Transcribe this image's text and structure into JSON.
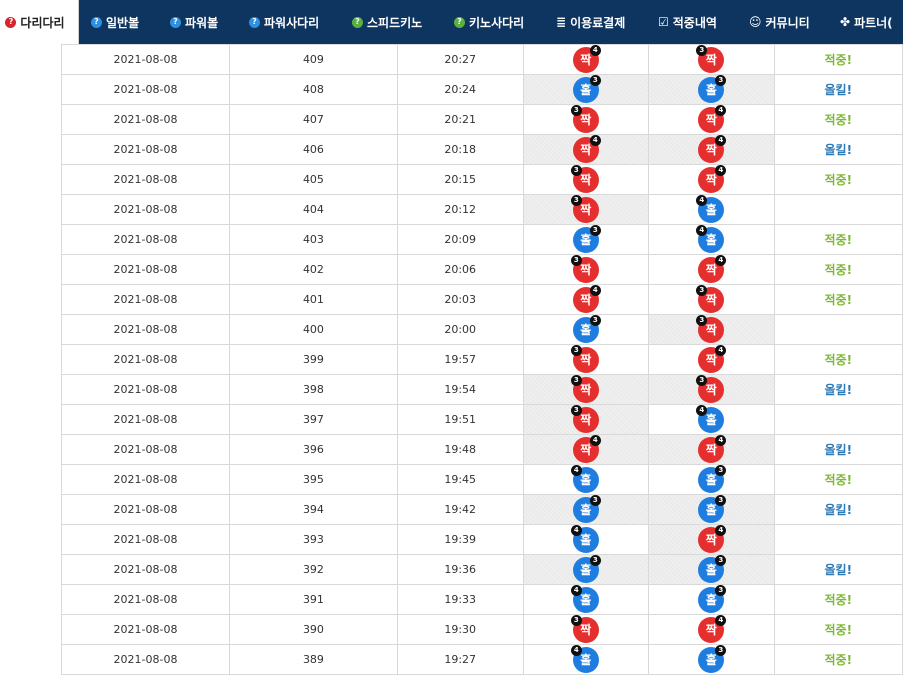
{
  "nav": [
    {
      "label": "다리다리",
      "icon": "question-circle-icon",
      "active": true
    },
    {
      "label": "일반볼",
      "icon": "question-circle-icon"
    },
    {
      "label": "파워볼",
      "icon": "question-circle-icon"
    },
    {
      "label": "파워사다리",
      "icon": "question-circle-icon"
    },
    {
      "label": "스피드키노",
      "icon": "question-circle-icon"
    },
    {
      "label": "키노사다리",
      "icon": "question-circle-icon"
    },
    {
      "label": "이용료결제",
      "icon": "database-icon"
    },
    {
      "label": "적중내역",
      "icon": "check-square-icon"
    },
    {
      "label": "커뮤니티",
      "icon": "smile-icon"
    },
    {
      "label": "파트너(",
      "icon": "cubes-icon"
    }
  ],
  "colors": {
    "nav_bg": "#0e3460",
    "odd_ball": "#1f7de0",
    "even_ball": "#e52e2e",
    "hit_text": "#7cb834",
    "miss_text": "#2a7ab8"
  },
  "labels": {
    "odd": "홀",
    "even": "짝",
    "hit": "적중!",
    "miss": "올킬!"
  },
  "rows": [
    {
      "date": "2021-08-08",
      "round": "409",
      "time": "20:27",
      "result": {
        "type": "even",
        "count": "4",
        "pos": "right"
      },
      "pick": {
        "type": "even",
        "count": "3",
        "pos": "left"
      },
      "status": "hit",
      "status_text": "적중!",
      "hatch_result": false,
      "hatch_pick": false
    },
    {
      "date": "2021-08-08",
      "round": "408",
      "time": "20:24",
      "result": {
        "type": "odd",
        "count": "3",
        "pos": "right"
      },
      "pick": {
        "type": "odd",
        "count": "3",
        "pos": "right"
      },
      "status": "miss",
      "status_text": "올킬!",
      "hatch_result": true,
      "hatch_pick": true
    },
    {
      "date": "2021-08-08",
      "round": "407",
      "time": "20:21",
      "result": {
        "type": "even",
        "count": "3",
        "pos": "left"
      },
      "pick": {
        "type": "even",
        "count": "4",
        "pos": "right"
      },
      "status": "hit",
      "status_text": "적중!",
      "hatch_result": false,
      "hatch_pick": false
    },
    {
      "date": "2021-08-08",
      "round": "406",
      "time": "20:18",
      "result": {
        "type": "even",
        "count": "4",
        "pos": "right"
      },
      "pick": {
        "type": "even",
        "count": "4",
        "pos": "right"
      },
      "status": "miss",
      "status_text": "올킬!",
      "hatch_result": true,
      "hatch_pick": true
    },
    {
      "date": "2021-08-08",
      "round": "405",
      "time": "20:15",
      "result": {
        "type": "even",
        "count": "3",
        "pos": "left"
      },
      "pick": {
        "type": "even",
        "count": "4",
        "pos": "right"
      },
      "status": "hit",
      "status_text": "적중!",
      "hatch_result": false,
      "hatch_pick": false
    },
    {
      "date": "2021-08-08",
      "round": "404",
      "time": "20:12",
      "result": {
        "type": "even",
        "count": "3",
        "pos": "left"
      },
      "pick": {
        "type": "odd",
        "count": "4",
        "pos": "left"
      },
      "status": "",
      "status_text": "",
      "hatch_result": true,
      "hatch_pick": false
    },
    {
      "date": "2021-08-08",
      "round": "403",
      "time": "20:09",
      "result": {
        "type": "odd",
        "count": "3",
        "pos": "right"
      },
      "pick": {
        "type": "odd",
        "count": "4",
        "pos": "left"
      },
      "status": "hit",
      "status_text": "적중!",
      "hatch_result": false,
      "hatch_pick": false
    },
    {
      "date": "2021-08-08",
      "round": "402",
      "time": "20:06",
      "result": {
        "type": "even",
        "count": "3",
        "pos": "left"
      },
      "pick": {
        "type": "even",
        "count": "4",
        "pos": "right"
      },
      "status": "hit",
      "status_text": "적중!",
      "hatch_result": false,
      "hatch_pick": false
    },
    {
      "date": "2021-08-08",
      "round": "401",
      "time": "20:03",
      "result": {
        "type": "even",
        "count": "4",
        "pos": "right"
      },
      "pick": {
        "type": "even",
        "count": "3",
        "pos": "left"
      },
      "status": "hit",
      "status_text": "적중!",
      "hatch_result": false,
      "hatch_pick": false
    },
    {
      "date": "2021-08-08",
      "round": "400",
      "time": "20:00",
      "result": {
        "type": "odd",
        "count": "3",
        "pos": "right"
      },
      "pick": {
        "type": "even",
        "count": "3",
        "pos": "left"
      },
      "status": "",
      "status_text": "",
      "hatch_result": false,
      "hatch_pick": true
    },
    {
      "date": "2021-08-08",
      "round": "399",
      "time": "19:57",
      "result": {
        "type": "even",
        "count": "3",
        "pos": "left"
      },
      "pick": {
        "type": "even",
        "count": "4",
        "pos": "right"
      },
      "status": "hit",
      "status_text": "적중!",
      "hatch_result": false,
      "hatch_pick": false
    },
    {
      "date": "2021-08-08",
      "round": "398",
      "time": "19:54",
      "result": {
        "type": "even",
        "count": "3",
        "pos": "left"
      },
      "pick": {
        "type": "even",
        "count": "3",
        "pos": "left"
      },
      "status": "miss",
      "status_text": "올킬!",
      "hatch_result": true,
      "hatch_pick": true
    },
    {
      "date": "2021-08-08",
      "round": "397",
      "time": "19:51",
      "result": {
        "type": "even",
        "count": "3",
        "pos": "left"
      },
      "pick": {
        "type": "odd",
        "count": "4",
        "pos": "left"
      },
      "status": "",
      "status_text": "",
      "hatch_result": true,
      "hatch_pick": false
    },
    {
      "date": "2021-08-08",
      "round": "396",
      "time": "19:48",
      "result": {
        "type": "even",
        "count": "4",
        "pos": "right"
      },
      "pick": {
        "type": "even",
        "count": "4",
        "pos": "right"
      },
      "status": "miss",
      "status_text": "올킬!",
      "hatch_result": true,
      "hatch_pick": true
    },
    {
      "date": "2021-08-08",
      "round": "395",
      "time": "19:45",
      "result": {
        "type": "odd",
        "count": "4",
        "pos": "left"
      },
      "pick": {
        "type": "odd",
        "count": "3",
        "pos": "right"
      },
      "status": "hit",
      "status_text": "적중!",
      "hatch_result": false,
      "hatch_pick": false
    },
    {
      "date": "2021-08-08",
      "round": "394",
      "time": "19:42",
      "result": {
        "type": "odd",
        "count": "3",
        "pos": "right"
      },
      "pick": {
        "type": "odd",
        "count": "3",
        "pos": "right"
      },
      "status": "miss",
      "status_text": "올킬!",
      "hatch_result": true,
      "hatch_pick": true
    },
    {
      "date": "2021-08-08",
      "round": "393",
      "time": "19:39",
      "result": {
        "type": "odd",
        "count": "4",
        "pos": "left"
      },
      "pick": {
        "type": "even",
        "count": "4",
        "pos": "right"
      },
      "status": "",
      "status_text": "",
      "hatch_result": false,
      "hatch_pick": true
    },
    {
      "date": "2021-08-08",
      "round": "392",
      "time": "19:36",
      "result": {
        "type": "odd",
        "count": "3",
        "pos": "right"
      },
      "pick": {
        "type": "odd",
        "count": "3",
        "pos": "right"
      },
      "status": "miss",
      "status_text": "올킬!",
      "hatch_result": true,
      "hatch_pick": true
    },
    {
      "date": "2021-08-08",
      "round": "391",
      "time": "19:33",
      "result": {
        "type": "odd",
        "count": "4",
        "pos": "left"
      },
      "pick": {
        "type": "odd",
        "count": "3",
        "pos": "right"
      },
      "status": "hit",
      "status_text": "적중!",
      "hatch_result": false,
      "hatch_pick": false
    },
    {
      "date": "2021-08-08",
      "round": "390",
      "time": "19:30",
      "result": {
        "type": "even",
        "count": "3",
        "pos": "left"
      },
      "pick": {
        "type": "even",
        "count": "4",
        "pos": "right"
      },
      "status": "hit",
      "status_text": "적중!",
      "hatch_result": false,
      "hatch_pick": false
    },
    {
      "date": "2021-08-08",
      "round": "389",
      "time": "19:27",
      "result": {
        "type": "odd",
        "count": "4",
        "pos": "left"
      },
      "pick": {
        "type": "odd",
        "count": "3",
        "pos": "right"
      },
      "status": "hit",
      "status_text": "적중!",
      "hatch_result": false,
      "hatch_pick": false
    }
  ]
}
